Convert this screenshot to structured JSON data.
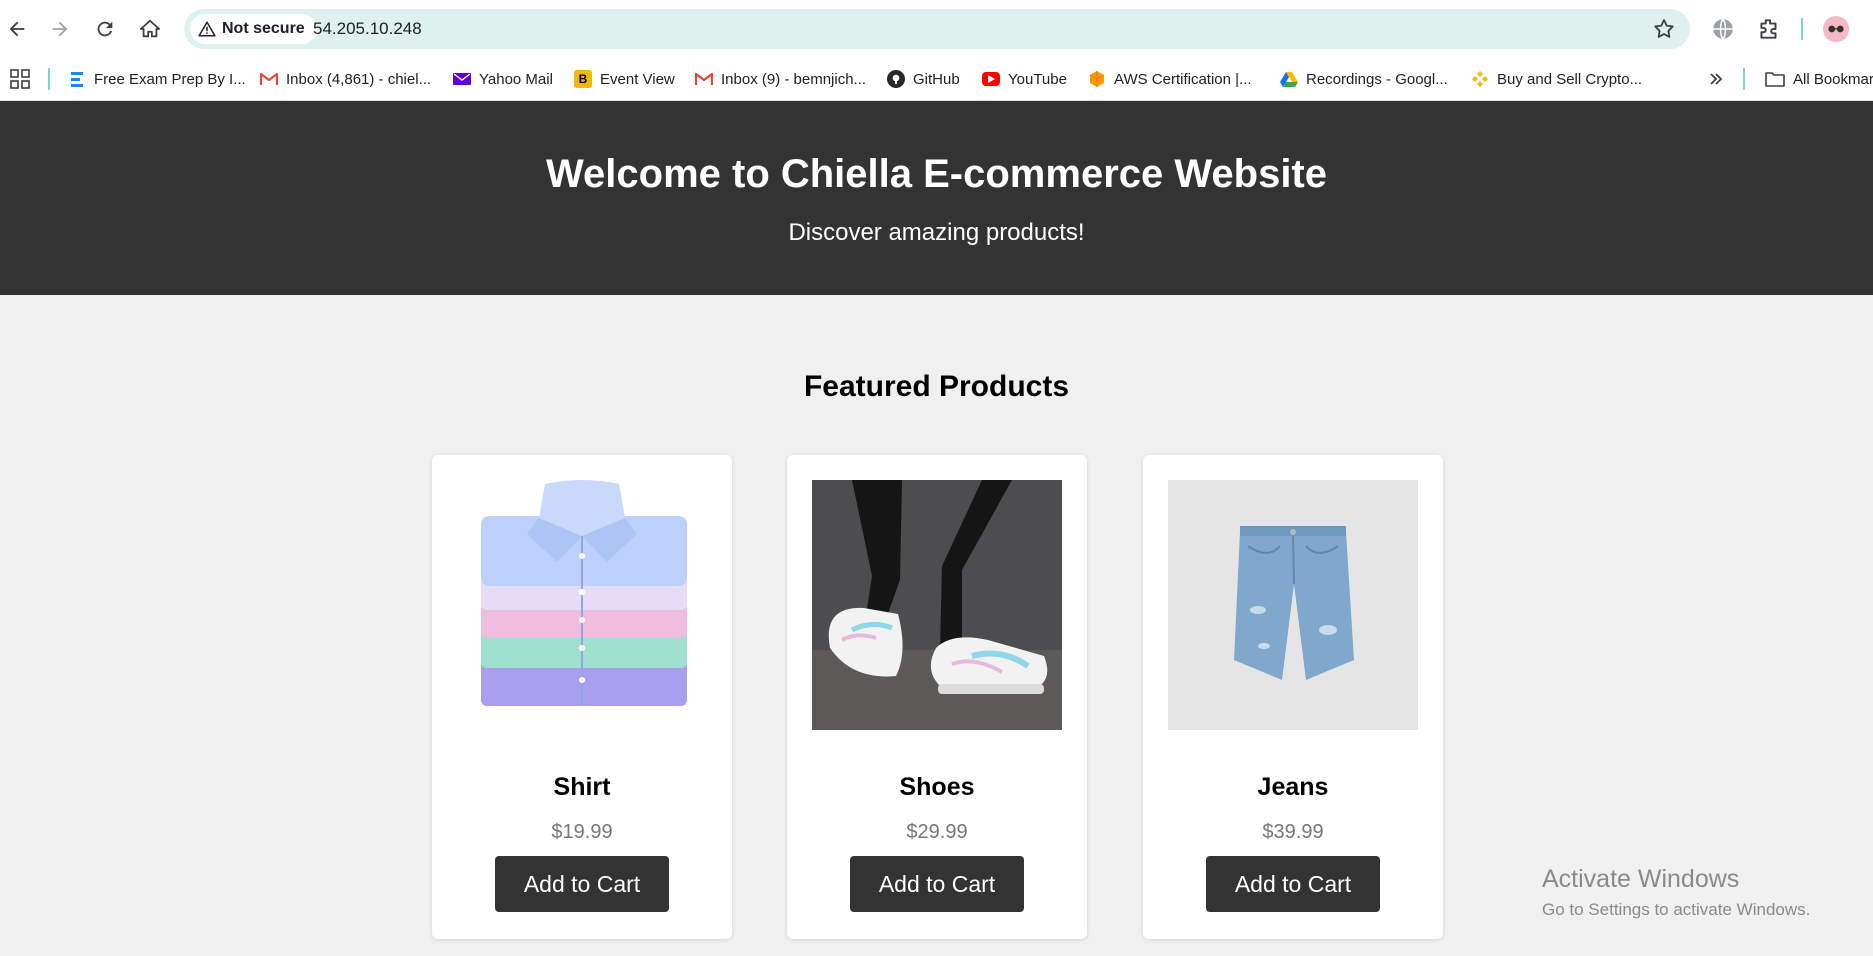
{
  "browser": {
    "security_label": "Not secure",
    "url": "54.205.10.248",
    "bookmarks": [
      {
        "label": "Free Exam Prep By I...",
        "icon": "exam-prep-icon"
      },
      {
        "label": "Inbox (4,861) - chiel...",
        "icon": "gmail-icon"
      },
      {
        "label": "Yahoo Mail",
        "icon": "yahoo-mail-icon"
      },
      {
        "label": "Event View",
        "icon": "event-view-icon"
      },
      {
        "label": "Inbox (9) - bemnjich...",
        "icon": "gmail-icon"
      },
      {
        "label": "GitHub",
        "icon": "github-icon"
      },
      {
        "label": "YouTube",
        "icon": "youtube-icon"
      },
      {
        "label": "AWS Certification |...",
        "icon": "aws-icon"
      },
      {
        "label": "Recordings - Googl...",
        "icon": "google-drive-icon"
      },
      {
        "label": "Buy and Sell Crypto...",
        "icon": "binance-icon"
      }
    ],
    "all_bookmarks_label": "All Bookmarks"
  },
  "hero": {
    "title": "Welcome to Chiella E-commerce Website",
    "subtitle": "Discover amazing products!"
  },
  "featured": {
    "title": "Featured Products",
    "products": [
      {
        "name": "Shirt",
        "price": "$19.99",
        "button": "Add to Cart"
      },
      {
        "name": "Shoes",
        "price": "$29.99",
        "button": "Add to Cart"
      },
      {
        "name": "Jeans",
        "price": "$39.99",
        "button": "Add to Cart"
      }
    ]
  },
  "watermark": {
    "line1": "Activate Windows",
    "line2": "Go to Settings to activate Windows."
  }
}
